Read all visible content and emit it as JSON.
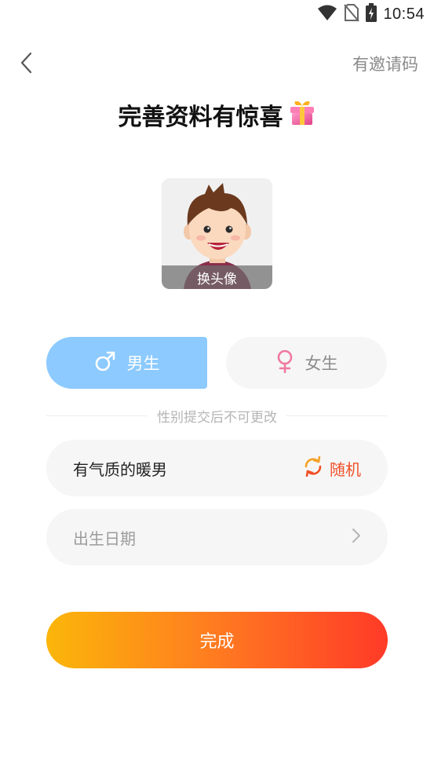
{
  "status_bar": {
    "time": "10:54",
    "icons": [
      "wifi-icon",
      "no-sim-icon",
      "battery-charging-icon"
    ]
  },
  "header": {
    "back_icon": "chevron-left-icon",
    "invite_label": "有邀请码"
  },
  "title": {
    "text": "完善资料有惊喜",
    "emoji_icon": "gift-icon"
  },
  "avatar": {
    "change_label": "换头像"
  },
  "gender": {
    "male_label": "男生",
    "female_label": "女生",
    "selected": "male",
    "note": "性别提交后不可更改"
  },
  "nickname": {
    "value": "有气质的暖男",
    "random_label": "随机",
    "random_icon": "refresh-icon"
  },
  "birth_date": {
    "placeholder": "出生日期",
    "arrow_icon": "chevron-right-icon"
  },
  "submit": {
    "label": "完成"
  },
  "colors": {
    "male_selected_bg": "#8ccaff",
    "female_icon": "#f07aa0",
    "random_accent": "#f05028",
    "button_gradient_start": "#fbb60a",
    "button_gradient_end": "#ff3a28"
  }
}
